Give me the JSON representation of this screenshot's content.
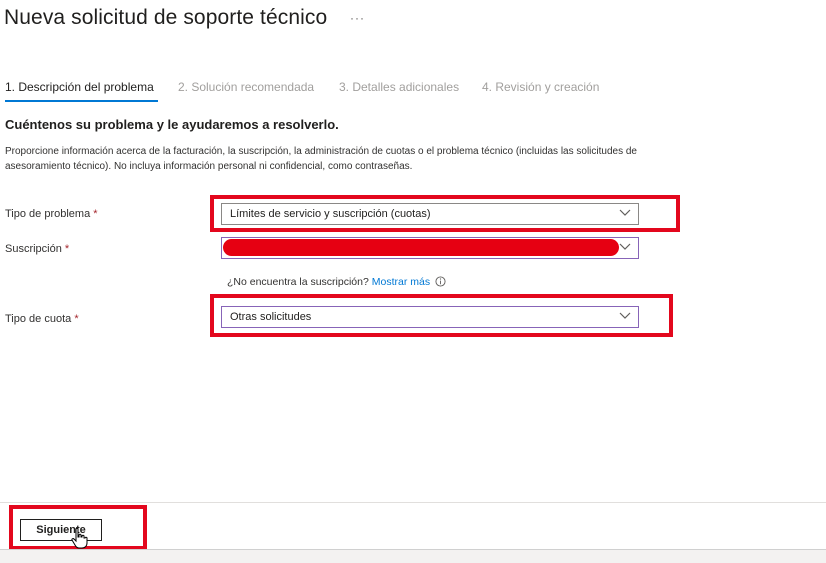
{
  "header": {
    "title": "Nueva solicitud de soporte técnico",
    "more_icon": "ellipsis-icon"
  },
  "steps": [
    {
      "label": "1. Descripción del problema",
      "active": true
    },
    {
      "label": "2. Solución recomendada",
      "active": false
    },
    {
      "label": "3. Detalles adicionales",
      "active": false
    },
    {
      "label": "4. Revisión y creación",
      "active": false
    }
  ],
  "form": {
    "heading": "Cuéntenos su problema y le ayudaremos a resolverlo.",
    "intro": "Proporcione información acerca de la facturación, la suscripción, la administración de cuotas o el problema técnico (incluidas las solicitudes de asesoramiento técnico). No incluya información personal ni confidencial, como contraseñas.",
    "problem_type": {
      "label": "Tipo de problema",
      "required_mark": "*",
      "value": "Límites de servicio y suscripción (cuotas)"
    },
    "subscription": {
      "label": "Suscripción",
      "required_mark": "*",
      "value": ""
    },
    "subscription_hint": {
      "text": "¿No encuentra la suscripción?",
      "link": "Mostrar más"
    },
    "quota_type": {
      "label": "Tipo de cuota",
      "required_mark": "*",
      "value": "Otras solicitudes"
    }
  },
  "footer": {
    "next_label": "Siguiente"
  },
  "colors": {
    "accent": "#0078d4",
    "annotation_red": "#e3071d",
    "required": "#a4262c"
  }
}
